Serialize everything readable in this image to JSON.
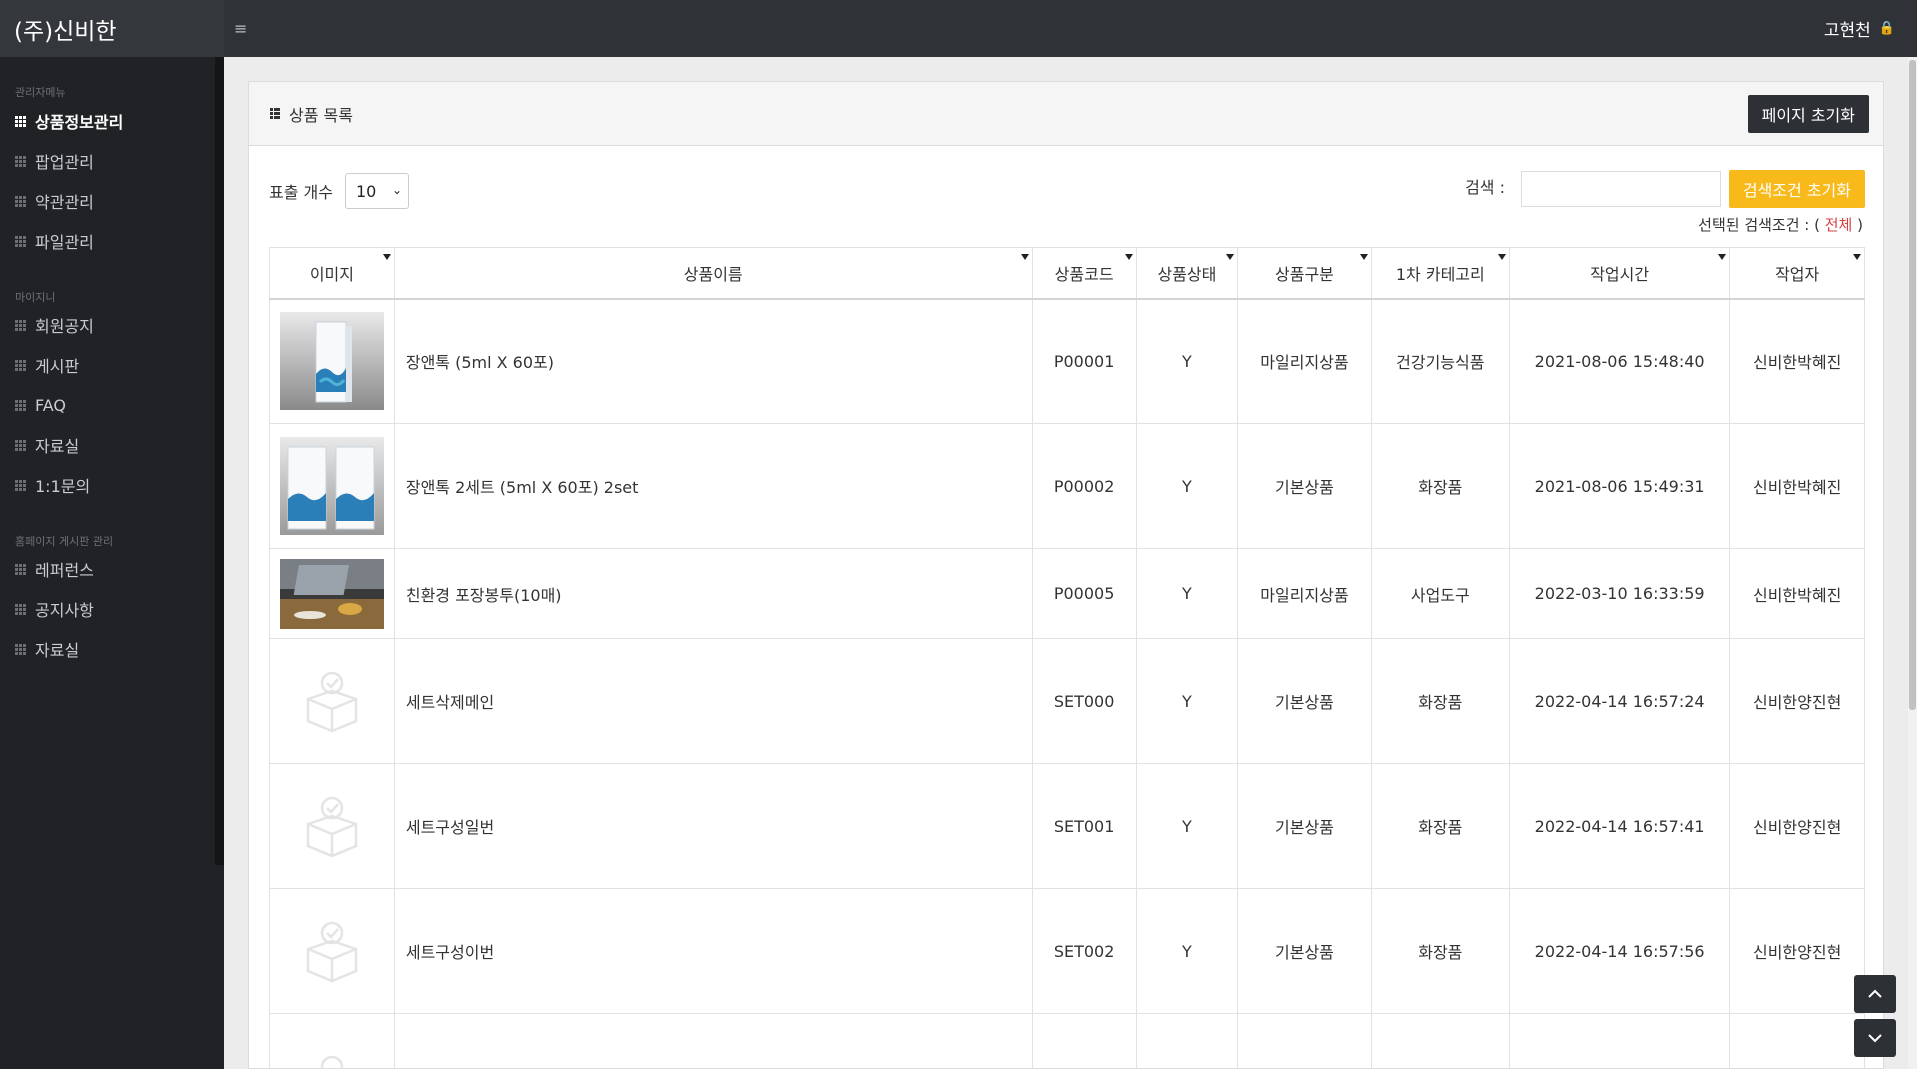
{
  "app": {
    "brand": "(주)신비한",
    "user": "고현천"
  },
  "sidebar": {
    "sections": [
      {
        "title": "관리자메뉴",
        "items": [
          {
            "label": "상품정보관리",
            "active": true
          },
          {
            "label": "팝업관리"
          },
          {
            "label": "약관관리"
          },
          {
            "label": "파일관리"
          }
        ]
      },
      {
        "title": "마이지니",
        "items": [
          {
            "label": "회원공지"
          },
          {
            "label": "게시판"
          },
          {
            "label": "FAQ"
          },
          {
            "label": "자료실"
          },
          {
            "label": "1:1문의"
          }
        ]
      },
      {
        "title": "홈페이지 게시판 관리",
        "items": [
          {
            "label": "레퍼런스"
          },
          {
            "label": "공지사항"
          },
          {
            "label": "자료실"
          }
        ]
      }
    ]
  },
  "panel": {
    "title": "상품 목록",
    "reset_page_label": "페이지 초기화",
    "count_label": "표출 개수",
    "count_value": "10",
    "search_label": "검색 :",
    "search_value": "",
    "reset_search_label": "검색조건 초기화",
    "selected_label": "선택된 검색조건 : (",
    "selected_value": "전체",
    "selected_close": ")"
  },
  "table": {
    "columns": [
      "이미지",
      "상품이름",
      "상품코드",
      "상품상태",
      "상품구분",
      "1차 카테고리",
      "작업시간",
      "작업자"
    ],
    "rows": [
      {
        "image": "product-box-single",
        "name": "장앤톡 (5ml X 60포)",
        "code": "P00001",
        "status": "Y",
        "type": "마일리지상품",
        "category": "건강기능식품",
        "time": "2021-08-06 15:48:40",
        "worker": "신비한박혜진"
      },
      {
        "image": "product-box-double",
        "name": "장앤톡 2세트 (5ml X 60포) 2set",
        "code": "P00002",
        "status": "Y",
        "type": "기본상품",
        "category": "화장품",
        "time": "2021-08-06 15:49:31",
        "worker": "신비한박혜진"
      },
      {
        "image": "desk-photo",
        "name": "친환경 포장봉투(10매)",
        "code": "P00005",
        "status": "Y",
        "type": "마일리지상품",
        "category": "사업도구",
        "time": "2022-03-10 16:33:59",
        "worker": "신비한박혜진"
      },
      {
        "image": "box-placeholder-icon",
        "name": "세트삭제메인",
        "code": "SET000",
        "status": "Y",
        "type": "기본상품",
        "category": "화장품",
        "time": "2022-04-14 16:57:24",
        "worker": "신비한양진현"
      },
      {
        "image": "box-placeholder-icon",
        "name": "세트구성일번",
        "code": "SET001",
        "status": "Y",
        "type": "기본상품",
        "category": "화장품",
        "time": "2022-04-14 16:57:41",
        "worker": "신비한양진현"
      },
      {
        "image": "box-placeholder-icon",
        "name": "세트구성이번",
        "code": "SET002",
        "status": "Y",
        "type": "기본상품",
        "category": "화장품",
        "time": "2022-04-14 16:57:56",
        "worker": "신비한양진현"
      },
      {
        "image": "box-placeholder-icon",
        "name": "",
        "code": "",
        "status": "",
        "type": "",
        "category": "",
        "time": "",
        "worker": ""
      }
    ]
  },
  "colors": {
    "topbar": "#2f3237",
    "sidebar": "#202225",
    "accent_yellow": "#f8b91a",
    "dark_button": "#2d3136",
    "highlight_red": "#d94141"
  }
}
